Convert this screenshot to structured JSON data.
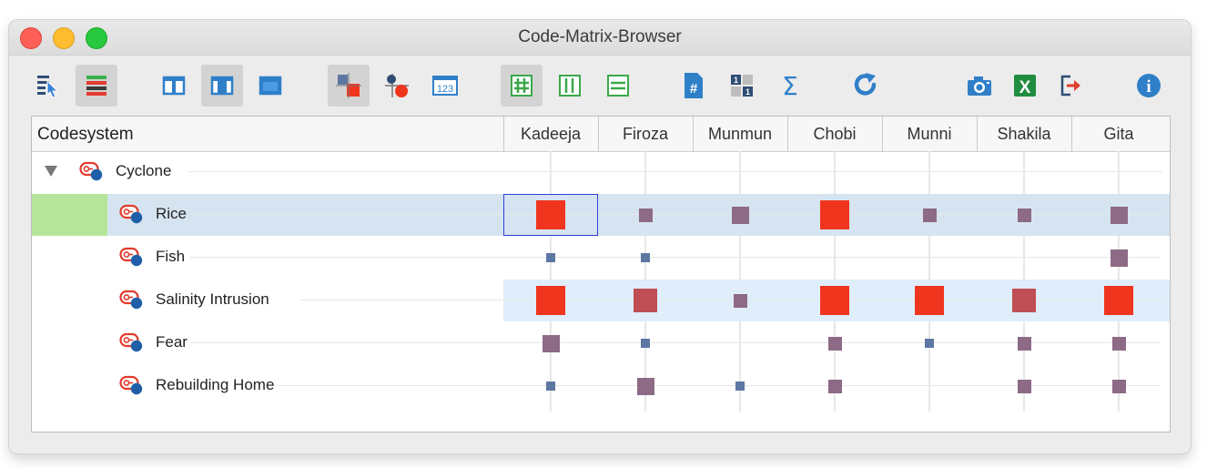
{
  "window": {
    "title": "Code-Matrix-Browser"
  },
  "toolbar": {
    "buttons": [
      {
        "name": "select-mode-icon",
        "active": false
      },
      {
        "name": "code-colors-icon",
        "active": true
      },
      {
        "name": "layout-top-icon",
        "active": false
      },
      {
        "name": "layout-middle-icon",
        "active": true
      },
      {
        "name": "layout-full-icon",
        "active": false
      },
      {
        "name": "squares-view-icon",
        "active": true
      },
      {
        "name": "symbols-view-icon",
        "active": false
      },
      {
        "name": "numbers-view-icon",
        "active": false,
        "label": "123"
      },
      {
        "name": "cell-grid-icon",
        "active": true
      },
      {
        "name": "column-view-icon",
        "active": false
      },
      {
        "name": "row-view-icon",
        "active": false
      },
      {
        "name": "hash-icon",
        "active": false,
        "label": "#"
      },
      {
        "name": "binary-icon",
        "active": false
      },
      {
        "name": "sigma-icon",
        "active": false,
        "label": "Σ"
      },
      {
        "name": "refresh-icon",
        "active": false
      },
      {
        "name": "camera-icon",
        "active": false
      },
      {
        "name": "excel-icon",
        "active": false,
        "label": "X"
      },
      {
        "name": "export-icon",
        "active": false
      },
      {
        "name": "info-icon",
        "active": false,
        "label": "i"
      }
    ]
  },
  "matrix": {
    "header": "Codesystem",
    "columns": [
      "Kadeeja",
      "Firoza",
      "Munmun",
      "Chobi",
      "Munni",
      "Shakila",
      "Gita"
    ],
    "parent": {
      "label": "Cyclone",
      "expanded": true
    },
    "rows": [
      {
        "label": "Rice",
        "selected": true,
        "values": [
          3,
          1,
          2,
          3,
          1,
          1,
          2
        ]
      },
      {
        "label": "Fish",
        "selected": false,
        "values": [
          0.5,
          0.5,
          0,
          0,
          0,
          0,
          2
        ]
      },
      {
        "label": "Salinity Intrusion",
        "selected": false,
        "highlighted": true,
        "values": [
          3,
          2.6,
          1.5,
          3,
          3,
          2.4,
          3
        ]
      },
      {
        "label": "Fear",
        "selected": false,
        "values": [
          2,
          0.5,
          0,
          1.3,
          0.5,
          1.3,
          1.3
        ]
      },
      {
        "label": "Rebuilding Home",
        "selected": false,
        "values": [
          0.5,
          2,
          0.5,
          1.3,
          0,
          1.3,
          1.3
        ]
      }
    ],
    "colors": {
      "selected_row": "#d6e4f1",
      "highlight_row": "#e0eefb",
      "selection_green": "#b6e59a",
      "level_small": "#5d77a3",
      "level_mid": "#8d6a85",
      "level_high": "#bf4f55",
      "level_max": "#f0351f"
    }
  }
}
